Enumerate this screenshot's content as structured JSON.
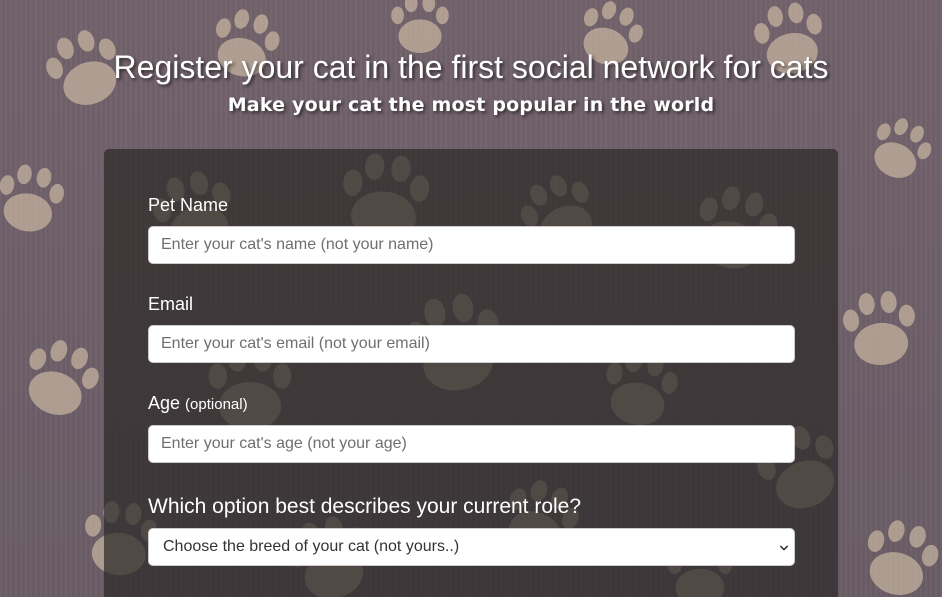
{
  "header": {
    "title": "Register your cat in the first social network for cats",
    "subtitle": "Make your cat the most popular in the world"
  },
  "form": {
    "pet_name": {
      "label": "Pet Name",
      "placeholder": "Enter your cat's name (not your name)",
      "value": ""
    },
    "email": {
      "label": "Email",
      "placeholder": "Enter your cat's email (not your email)",
      "value": ""
    },
    "age": {
      "label": "Age",
      "optional_note": "(optional)",
      "placeholder": "Enter your cat's age (not your age)",
      "value": ""
    },
    "role": {
      "question": "Which option best describes your current role?",
      "selected": "Choose the breed of your cat (not yours..)"
    }
  },
  "icons": {
    "background": "paw-print-icon",
    "select": "chevron-down-icon"
  },
  "colors": {
    "background": "#6d5f67",
    "paw": "#c7b5a0",
    "card": "#2d2a28",
    "text": "#ffffff"
  }
}
